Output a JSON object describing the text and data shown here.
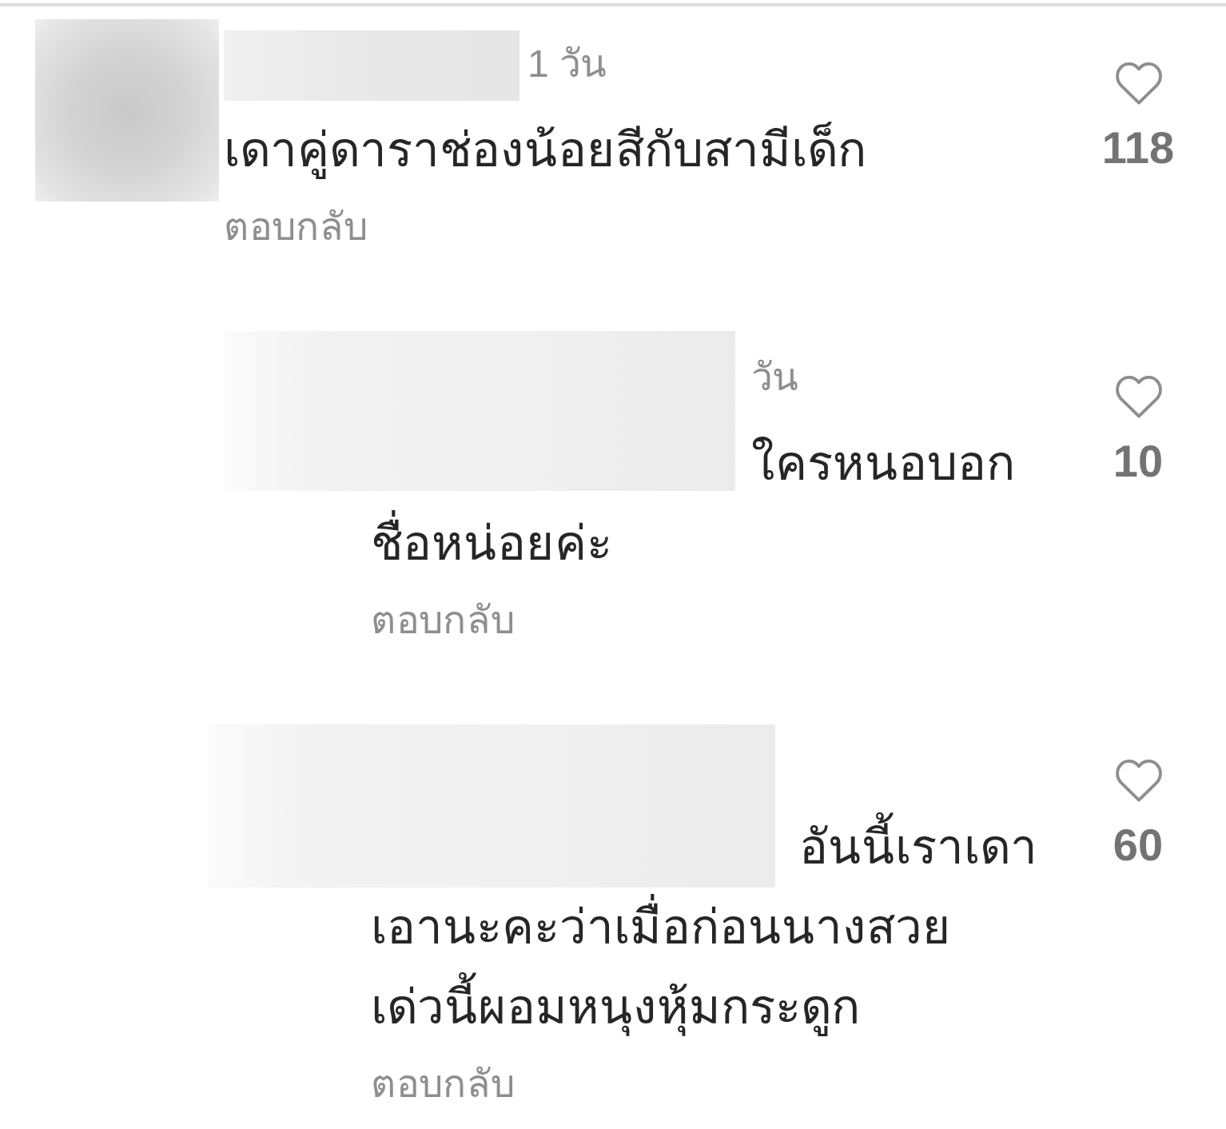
{
  "comments": [
    {
      "time": "1 วัน",
      "lines": [
        "เดาคู่ดาราช่องน้อยสีกับสามีเด็ก"
      ],
      "reply_label": "ตอบกลับ",
      "likes": "118",
      "liked": false,
      "children": [
        {
          "time": "วัน",
          "lines": [
            "ใครหนอบอก",
            "ชื่อหน่อยค่ะ"
          ],
          "reply_label": "ตอบกลับ",
          "likes": "10",
          "liked": false
        },
        {
          "lines": [
            "อันนี้เราเดา",
            "เอานะคะว่าเมื่อก่อนนางสวย",
            "เด่วนี้ผอมหนุงหุ้มกระดูก"
          ],
          "reply_label": "ตอบกลับ",
          "likes": "60",
          "liked": false
        }
      ]
    }
  ]
}
